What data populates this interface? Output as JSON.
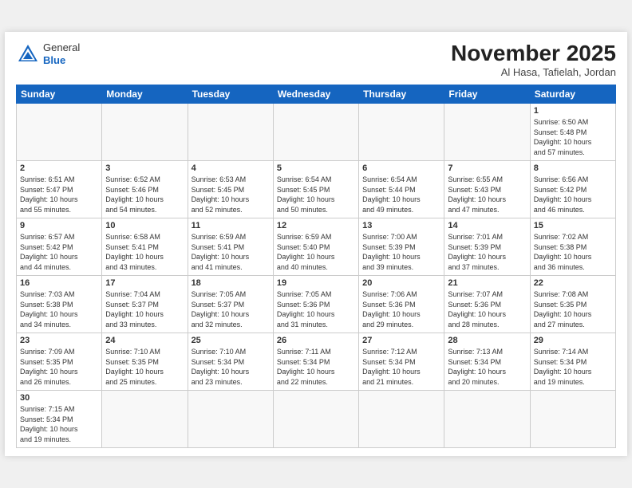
{
  "header": {
    "logo_general": "General",
    "logo_blue": "Blue",
    "month_title": "November 2025",
    "location": "Al Hasa, Tafielah, Jordan"
  },
  "days_of_week": [
    "Sunday",
    "Monday",
    "Tuesday",
    "Wednesday",
    "Thursday",
    "Friday",
    "Saturday"
  ],
  "weeks": [
    [
      {
        "day": "",
        "info": ""
      },
      {
        "day": "",
        "info": ""
      },
      {
        "day": "",
        "info": ""
      },
      {
        "day": "",
        "info": ""
      },
      {
        "day": "",
        "info": ""
      },
      {
        "day": "",
        "info": ""
      },
      {
        "day": "1",
        "info": "Sunrise: 6:50 AM\nSunset: 5:48 PM\nDaylight: 10 hours\nand 57 minutes."
      }
    ],
    [
      {
        "day": "2",
        "info": "Sunrise: 6:51 AM\nSunset: 5:47 PM\nDaylight: 10 hours\nand 55 minutes."
      },
      {
        "day": "3",
        "info": "Sunrise: 6:52 AM\nSunset: 5:46 PM\nDaylight: 10 hours\nand 54 minutes."
      },
      {
        "day": "4",
        "info": "Sunrise: 6:53 AM\nSunset: 5:45 PM\nDaylight: 10 hours\nand 52 minutes."
      },
      {
        "day": "5",
        "info": "Sunrise: 6:54 AM\nSunset: 5:45 PM\nDaylight: 10 hours\nand 50 minutes."
      },
      {
        "day": "6",
        "info": "Sunrise: 6:54 AM\nSunset: 5:44 PM\nDaylight: 10 hours\nand 49 minutes."
      },
      {
        "day": "7",
        "info": "Sunrise: 6:55 AM\nSunset: 5:43 PM\nDaylight: 10 hours\nand 47 minutes."
      },
      {
        "day": "8",
        "info": "Sunrise: 6:56 AM\nSunset: 5:42 PM\nDaylight: 10 hours\nand 46 minutes."
      }
    ],
    [
      {
        "day": "9",
        "info": "Sunrise: 6:57 AM\nSunset: 5:42 PM\nDaylight: 10 hours\nand 44 minutes."
      },
      {
        "day": "10",
        "info": "Sunrise: 6:58 AM\nSunset: 5:41 PM\nDaylight: 10 hours\nand 43 minutes."
      },
      {
        "day": "11",
        "info": "Sunrise: 6:59 AM\nSunset: 5:41 PM\nDaylight: 10 hours\nand 41 minutes."
      },
      {
        "day": "12",
        "info": "Sunrise: 6:59 AM\nSunset: 5:40 PM\nDaylight: 10 hours\nand 40 minutes."
      },
      {
        "day": "13",
        "info": "Sunrise: 7:00 AM\nSunset: 5:39 PM\nDaylight: 10 hours\nand 39 minutes."
      },
      {
        "day": "14",
        "info": "Sunrise: 7:01 AM\nSunset: 5:39 PM\nDaylight: 10 hours\nand 37 minutes."
      },
      {
        "day": "15",
        "info": "Sunrise: 7:02 AM\nSunset: 5:38 PM\nDaylight: 10 hours\nand 36 minutes."
      }
    ],
    [
      {
        "day": "16",
        "info": "Sunrise: 7:03 AM\nSunset: 5:38 PM\nDaylight: 10 hours\nand 34 minutes."
      },
      {
        "day": "17",
        "info": "Sunrise: 7:04 AM\nSunset: 5:37 PM\nDaylight: 10 hours\nand 33 minutes."
      },
      {
        "day": "18",
        "info": "Sunrise: 7:05 AM\nSunset: 5:37 PM\nDaylight: 10 hours\nand 32 minutes."
      },
      {
        "day": "19",
        "info": "Sunrise: 7:05 AM\nSunset: 5:36 PM\nDaylight: 10 hours\nand 31 minutes."
      },
      {
        "day": "20",
        "info": "Sunrise: 7:06 AM\nSunset: 5:36 PM\nDaylight: 10 hours\nand 29 minutes."
      },
      {
        "day": "21",
        "info": "Sunrise: 7:07 AM\nSunset: 5:36 PM\nDaylight: 10 hours\nand 28 minutes."
      },
      {
        "day": "22",
        "info": "Sunrise: 7:08 AM\nSunset: 5:35 PM\nDaylight: 10 hours\nand 27 minutes."
      }
    ],
    [
      {
        "day": "23",
        "info": "Sunrise: 7:09 AM\nSunset: 5:35 PM\nDaylight: 10 hours\nand 26 minutes."
      },
      {
        "day": "24",
        "info": "Sunrise: 7:10 AM\nSunset: 5:35 PM\nDaylight: 10 hours\nand 25 minutes."
      },
      {
        "day": "25",
        "info": "Sunrise: 7:10 AM\nSunset: 5:34 PM\nDaylight: 10 hours\nand 23 minutes."
      },
      {
        "day": "26",
        "info": "Sunrise: 7:11 AM\nSunset: 5:34 PM\nDaylight: 10 hours\nand 22 minutes."
      },
      {
        "day": "27",
        "info": "Sunrise: 7:12 AM\nSunset: 5:34 PM\nDaylight: 10 hours\nand 21 minutes."
      },
      {
        "day": "28",
        "info": "Sunrise: 7:13 AM\nSunset: 5:34 PM\nDaylight: 10 hours\nand 20 minutes."
      },
      {
        "day": "29",
        "info": "Sunrise: 7:14 AM\nSunset: 5:34 PM\nDaylight: 10 hours\nand 19 minutes."
      }
    ],
    [
      {
        "day": "30",
        "info": "Sunrise: 7:15 AM\nSunset: 5:34 PM\nDaylight: 10 hours\nand 19 minutes."
      },
      {
        "day": "",
        "info": ""
      },
      {
        "day": "",
        "info": ""
      },
      {
        "day": "",
        "info": ""
      },
      {
        "day": "",
        "info": ""
      },
      {
        "day": "",
        "info": ""
      },
      {
        "day": "",
        "info": ""
      }
    ]
  ]
}
